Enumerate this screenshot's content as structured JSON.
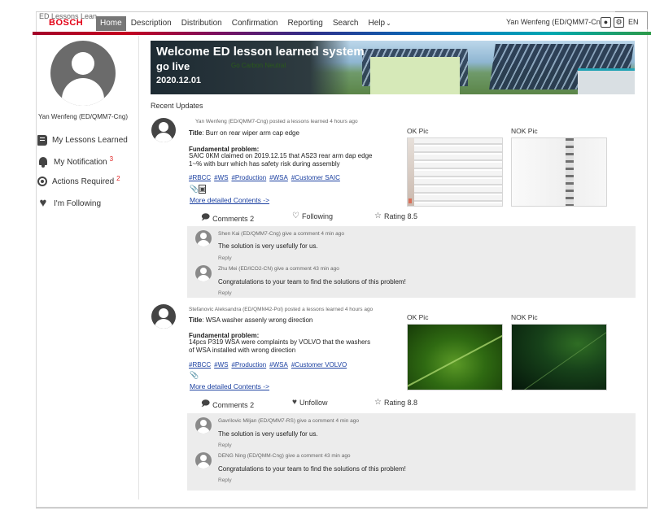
{
  "window": {
    "title": "ED Lessons Lean..."
  },
  "brand": {
    "logo": "BOSCH",
    "accent": "#e20015"
  },
  "nav": {
    "items": [
      {
        "label": "Home",
        "active": true
      },
      {
        "label": "Description"
      },
      {
        "label": "Distribution"
      },
      {
        "label": "Confirmation"
      },
      {
        "label": "Reporting"
      },
      {
        "label": "Search"
      },
      {
        "label": "Help",
        "caret": "⌄"
      }
    ],
    "user": "Yan Wenfeng (ED/QMM7-Cng)",
    "lang": "EN"
  },
  "sidebar": {
    "user": "Yan Wenfeng (ED/QMM7-Cng)",
    "items": [
      {
        "label": "My Lessons Learned",
        "icon": "book-icon"
      },
      {
        "label": "My Notification",
        "icon": "bell-icon",
        "badge": "3"
      },
      {
        "label": "Actions Required",
        "icon": "target-icon",
        "badge": "2"
      },
      {
        "label": "I'm Following",
        "icon": "heart-icon"
      }
    ]
  },
  "banner": {
    "line1": "Welcome ED lesson learned system",
    "line2": "go live",
    "line3": "2020.12.01",
    "badge": "Go Carbon Neutral"
  },
  "feed": {
    "heading": "Recent Updates",
    "posts": [
      {
        "meta": "Yan Wenfeng (ED/QMM7-Cng) posted a lessons learned 4 hours ago",
        "title_label": "Title",
        "title": ": Burr on rear wiper arm cap edge",
        "problem_label": "Fundamental problem:",
        "problem_line1": "SAIC 0KM claimed on 2019.12.15 that AS23 rear arm dap edge",
        "problem_line2": "1~% with burr which has safety risk during assembly",
        "tags": [
          "#RBCC",
          "#WS",
          "#Production",
          "#WSA",
          "#Customer SAIC"
        ],
        "more": "More detailed Contents ->",
        "ok_label": "OK Pic",
        "nok_label": "NOK Pic",
        "comments": "Comments 2",
        "follow": "Following",
        "rating": "Rating 8.5",
        "replies": [
          {
            "meta": "Shen Kai (ED/QMM7-Cng) give a comment 4 min ago",
            "text": "The solution is very usefully for us.",
            "reply": "Reply"
          },
          {
            "meta": "Zhu Mei (ED/ICO2-CN) give a comment 43 min ago",
            "text": "Congratulations to your team to find the solutions of this problem!",
            "reply": "Reply"
          }
        ]
      },
      {
        "meta": "Stefanovic Aleksandra (ED/QMM42-Pol) posted a lessons learned 4 hours ago",
        "title_label": "Title",
        "title": ": WSA washer assenly wrong direction",
        "problem_label": "Fundamental problem:",
        "problem_line1": "14pcs P319 WSA were complaints by VOLVO that the washers",
        "problem_line2": "of WSA installed with wrong direction",
        "tags": [
          "#RBCC",
          "#WS",
          "#Production",
          "#WSA",
          "#Customer VOLVO"
        ],
        "more": "More detailed Contents ->",
        "ok_label": "OK Pic",
        "nok_label": "NOK Pic",
        "comments": "Comments 2",
        "follow": "Unfollow",
        "rating": "Rating 8.8",
        "replies": [
          {
            "meta": "Gavrilovic Miljan (ED/QMM7-RS) give a comment 4 min ago",
            "text": "The solution is very usefully for us.",
            "reply": "Reply"
          },
          {
            "meta": "DENG Ning (ED/QMM-Cng) give a comment 43 min ago",
            "text": "Congratulations to your team to find the solutions of this problem!",
            "reply": "Reply"
          }
        ]
      }
    ]
  }
}
